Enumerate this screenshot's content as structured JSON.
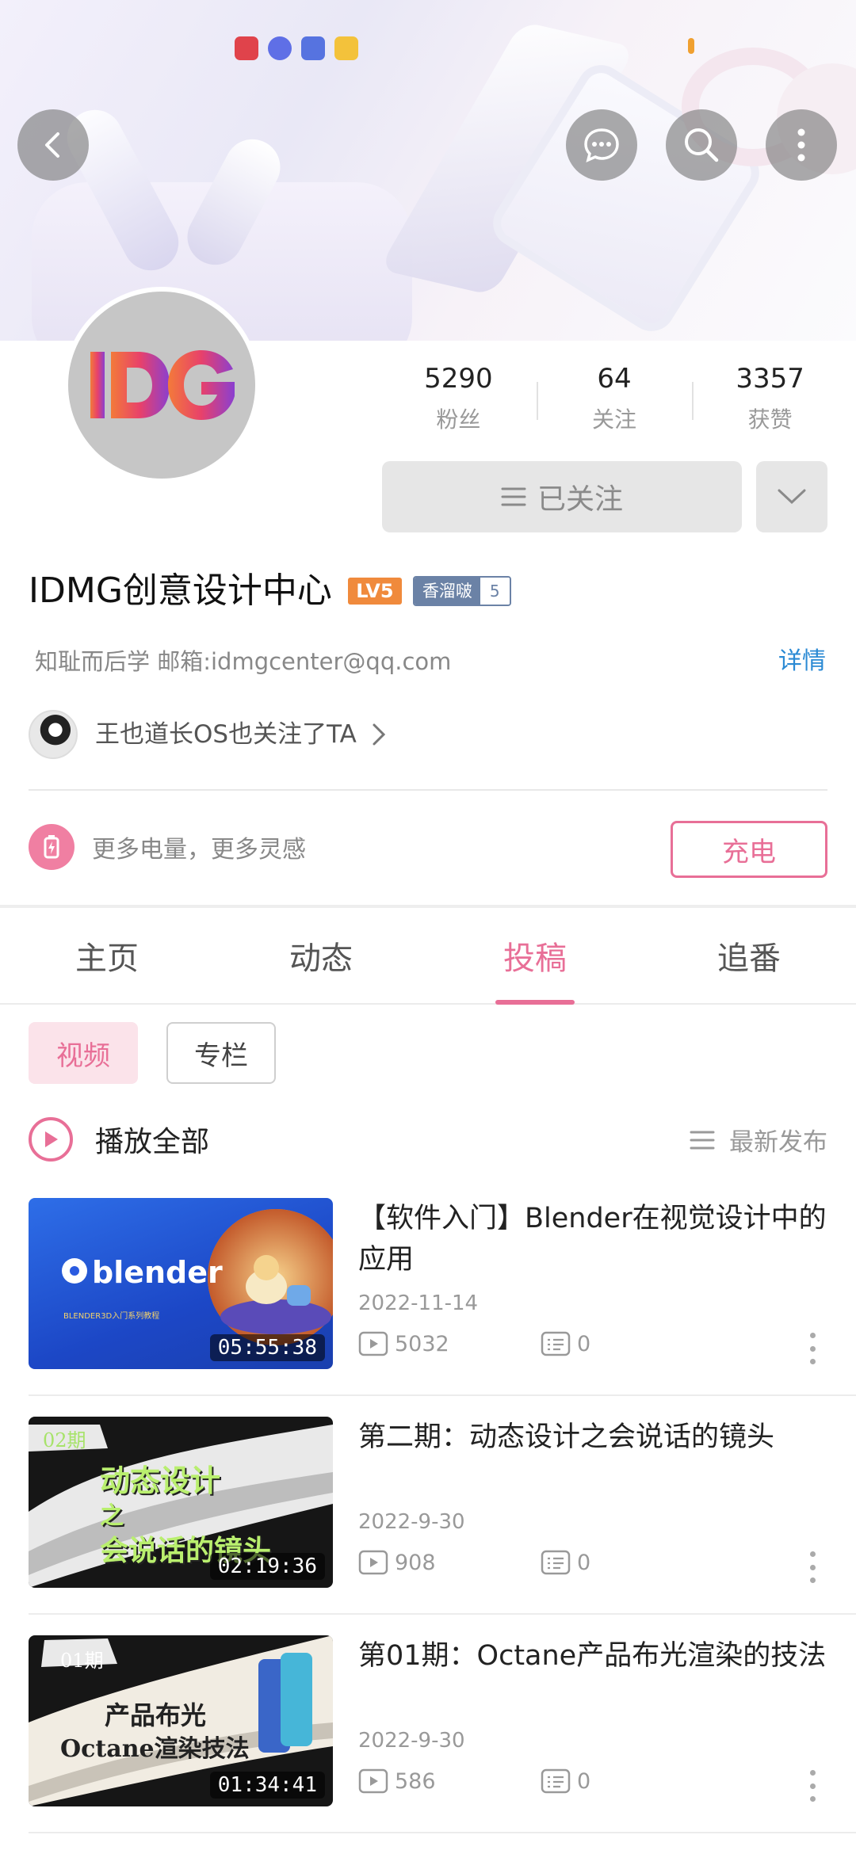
{
  "header": {
    "back_icon": "back-arrow-icon",
    "message_icon": "message-icon",
    "search_icon": "search-icon",
    "more_icon": "more-vertical-icon"
  },
  "profile": {
    "avatar_text": "IDG",
    "name": "IDMG创意设计中心",
    "level_badge": "LV5",
    "medal_name": "香溜啵",
    "medal_level": "5",
    "bio": "知耻而后学 邮箱:idmgcenter@qq.com",
    "detail_link": "详情",
    "follower_note": "王也道长OS也关注了TA"
  },
  "stats": [
    {
      "value": "5290",
      "label": "粉丝"
    },
    {
      "value": "64",
      "label": "关注"
    },
    {
      "value": "3357",
      "label": "获赞"
    }
  ],
  "follow_button": {
    "label": "已关注"
  },
  "charge": {
    "text": "更多电量，更多灵感",
    "button": "充电"
  },
  "tabs": [
    {
      "label": "主页"
    },
    {
      "label": "动态"
    },
    {
      "label": "投稿"
    },
    {
      "label": "追番"
    }
  ],
  "active_tab": "投稿",
  "chips": [
    {
      "label": "视频"
    },
    {
      "label": "专栏"
    }
  ],
  "play_all": {
    "label": "播放全部",
    "sort_label": "最新发布"
  },
  "videos": [
    {
      "title": "【软件入门】Blender在视觉设计中的应用",
      "date": "2022-11-14",
      "views": "5032",
      "comments": "0",
      "duration": "05:55:38",
      "thumb_text": "blender",
      "thumb_sub": "BLENDER3D入门系列教程"
    },
    {
      "title": "第二期：动态设计之会说话的镜头",
      "date": "2022-9-30",
      "views": "908",
      "comments": "0",
      "duration": "02:19:36",
      "thumb_tag": "02期",
      "thumb_line1": "动态设计",
      "thumb_line2": "之",
      "thumb_line3": "会说话的镜头"
    },
    {
      "title": "第01期：Octane产品布光渲染的技法",
      "date": "2022-9-30",
      "views": "586",
      "comments": "0",
      "duration": "01:34:41",
      "thumb_tag": "01期",
      "thumb_line1": "产品布光",
      "thumb_line2": "Octane渲染技法"
    }
  ],
  "colors": {
    "accent": "#e86f97",
    "link": "#2b8ad4",
    "level": "#f08a3c",
    "medal": "#6b82a6"
  }
}
